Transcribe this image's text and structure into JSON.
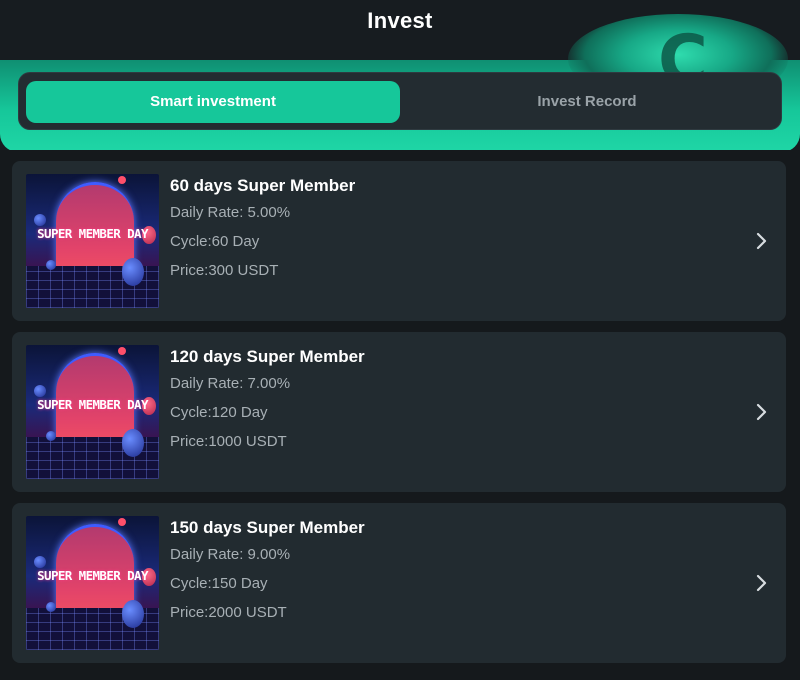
{
  "header": {
    "title": "Invest"
  },
  "tabs": [
    {
      "label": "Smart investment",
      "active": true
    },
    {
      "label": "Invest Record",
      "active": false
    }
  ],
  "products": [
    {
      "thumbnail_text": "SUPER MEMBER DAY",
      "name": "60 days Super Member",
      "daily_rate": "Daily Rate: 5.00%",
      "cycle": "Cycle:60 Day",
      "price": "Price:300 USDT"
    },
    {
      "thumbnail_text": "SUPER MEMBER DAY",
      "name": "120 days Super Member",
      "daily_rate": "Daily Rate: 7.00%",
      "cycle": "Cycle:120 Day",
      "price": "Price:1000 USDT"
    },
    {
      "thumbnail_text": "SUPER MEMBER DAY",
      "name": "150 days Super Member",
      "daily_rate": "Daily Rate: 9.00%",
      "cycle": "Cycle:150 Day",
      "price": "Price:2000 USDT"
    }
  ],
  "icons": {
    "row_chevron": "chevron-right-icon",
    "header_decoration": "coin-icon"
  },
  "colors": {
    "accent": "#16c79a",
    "background": "#15191c",
    "card": "#222b30"
  }
}
